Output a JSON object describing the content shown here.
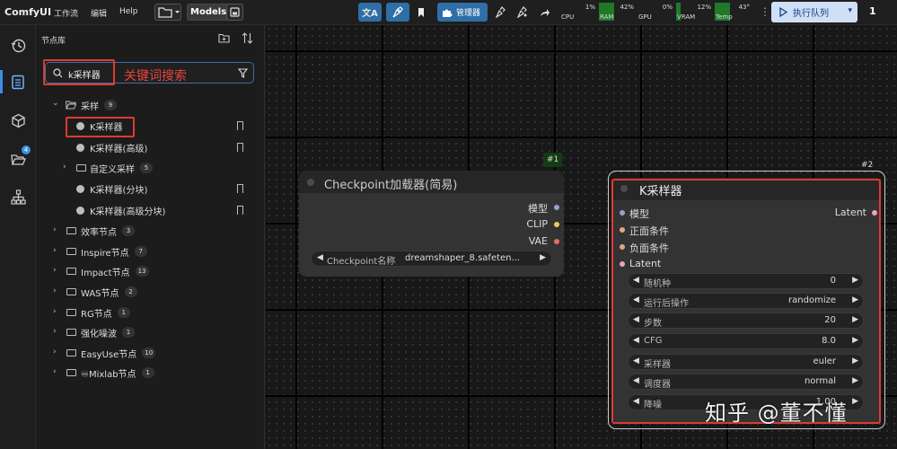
{
  "app": {
    "name": "ComfyUI"
  },
  "menu": [
    "工作流",
    "编辑",
    "Help"
  ],
  "toolbar": {
    "models_label": "Models",
    "manager_label": "管理器",
    "run_label": "执行队列",
    "queue_count": "1"
  },
  "monitor": [
    {
      "label": "CPU",
      "value": "1%",
      "percent": 1
    },
    {
      "label": "RAM",
      "value": "42%",
      "percent": 42
    },
    {
      "label": "GPU",
      "value": "0%",
      "percent": 0
    },
    {
      "label": "VRAM",
      "value": "12%",
      "percent": 12
    },
    {
      "label": "Temp",
      "value": "43°",
      "percent": 43
    }
  ],
  "sidebar": {
    "icons": [
      "history-icon",
      "node-library-icon",
      "model-library-icon",
      "workflows-icon",
      "templates-icon"
    ],
    "workflows_badge": "4"
  },
  "library": {
    "title": "节点库",
    "search_value": "k采样器",
    "annotation": "关键词搜索",
    "tree": [
      {
        "kind": "folder",
        "label": "采样",
        "count": "9",
        "expanded": true
      },
      {
        "kind": "node",
        "label": "K采样器",
        "highlighted": true
      },
      {
        "kind": "node",
        "label": "K采样器(高级)"
      },
      {
        "kind": "subfolder",
        "label": "自定义采样",
        "count": "5"
      },
      {
        "kind": "node",
        "label": "K采样器(分块)"
      },
      {
        "kind": "node",
        "label": "K采样器(高级分块)"
      },
      {
        "kind": "folder",
        "label": "效率节点",
        "count": "3"
      },
      {
        "kind": "folder",
        "label": "Inspire节点",
        "count": "7"
      },
      {
        "kind": "folder",
        "label": "Impact节点",
        "count": "13"
      },
      {
        "kind": "folder",
        "label": "WAS节点",
        "count": "2"
      },
      {
        "kind": "folder",
        "label": "RG节点",
        "count": "1"
      },
      {
        "kind": "folder",
        "label": "强化噪波",
        "count": "1"
      },
      {
        "kind": "folder",
        "label": "EasyUse节点",
        "count": "10"
      },
      {
        "kind": "folder",
        "label": "♾Mixlab节点",
        "count": "1"
      }
    ]
  },
  "node_checkpoint": {
    "id": "#1",
    "title": "Checkpoint加载器(简易)",
    "outputs": [
      "模型",
      "CLIP",
      "VAE"
    ],
    "widget": {
      "label": "Checkpoint名称",
      "value": "dreamshaper_8.safeten..."
    }
  },
  "node_ksampler": {
    "id": "#2",
    "title": "K采样器",
    "inputs": [
      "模型",
      "正面条件",
      "负面条件",
      "Latent"
    ],
    "output": "Latent",
    "widgets": [
      {
        "label": "随机种",
        "value": "0"
      },
      {
        "label": "运行后操作",
        "value": "randomize"
      },
      {
        "label": "步数",
        "value": "20"
      },
      {
        "label": "CFG",
        "value": "8.0"
      },
      {
        "label": "采样器",
        "value": "euler"
      },
      {
        "label": "调度器",
        "value": "normal"
      },
      {
        "label": "降噪",
        "value": "1.00"
      }
    ]
  },
  "watermark": "知乎 @董不懂",
  "colors": {
    "accent": "#2e6fa7",
    "highlight": "#e03a32",
    "port_model": "#9ca0c8",
    "port_clip": "#f0c85a",
    "port_vae": "#e86a6a",
    "port_cond": "#e8a57a",
    "port_latent": "#f0a0c0"
  }
}
